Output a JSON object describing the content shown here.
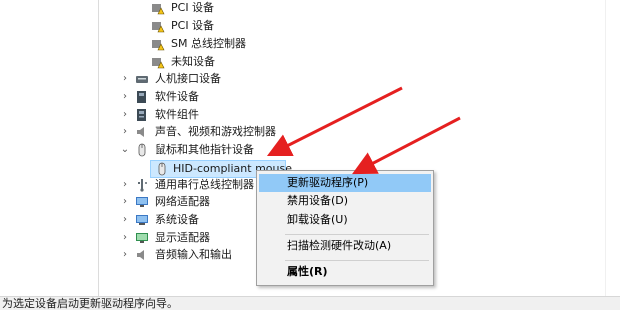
{
  "device_tree": {
    "partial_rows": [
      {
        "label": "PCI 设备"
      },
      {
        "label": "PCI 设备"
      },
      {
        "label": "SM 总线控制器"
      },
      {
        "label": "未知设备"
      }
    ],
    "categories": [
      {
        "label": "人机接口设备",
        "icon": "hid-icon",
        "expanded": false
      },
      {
        "label": "软件设备",
        "icon": "software-device-icon",
        "expanded": false
      },
      {
        "label": "软件组件",
        "icon": "software-component-icon",
        "expanded": false
      },
      {
        "label": "声音、视频和游戏控制器",
        "icon": "speaker-icon",
        "expanded": false
      },
      {
        "label": "鼠标和其他指针设备",
        "icon": "mouse-icon",
        "expanded": true
      },
      {
        "label": "通用串行总线控制器",
        "icon": "usb-icon",
        "expanded": false
      },
      {
        "label": "网络适配器",
        "icon": "network-icon",
        "expanded": false
      },
      {
        "label": "系统设备",
        "icon": "system-icon",
        "expanded": false
      },
      {
        "label": "显示适配器",
        "icon": "display-icon",
        "expanded": false
      },
      {
        "label": "音频输入和输出",
        "icon": "audio-io-icon",
        "expanded": false
      }
    ],
    "selected_device": {
      "label": "HID-compliant mouse",
      "icon": "mouse-icon"
    }
  },
  "context_menu": {
    "items": [
      {
        "label": "更新驱动程序(P)",
        "highlighted": true
      },
      {
        "label": "禁用设备(D)",
        "highlighted": false
      },
      {
        "label": "卸载设备(U)",
        "highlighted": false
      },
      {
        "label": "扫描检测硬件改动(A)",
        "highlighted": false
      },
      {
        "label": "属性(R)",
        "highlighted": false,
        "bold": true
      }
    ]
  },
  "status_bar": {
    "text": "为选定设备启动更新驱动程序向导。"
  },
  "colors": {
    "selection": "#cce8ff",
    "menu_highlight": "#91c9f7",
    "arrow": "#e52020"
  }
}
